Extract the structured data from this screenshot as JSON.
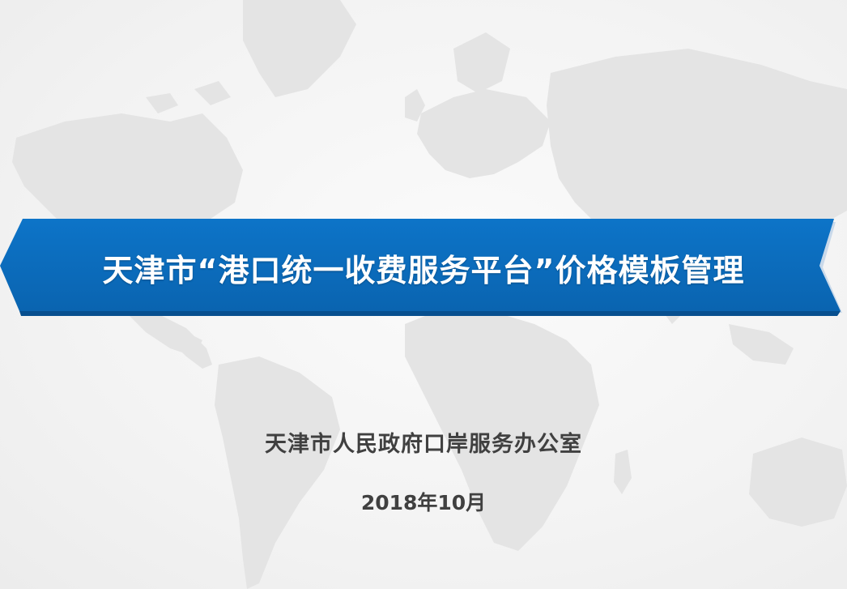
{
  "slide": {
    "title": "天津市“港口统一收费服务平台”价格模板管理",
    "organization": "天津市人民政府口岸服务办公室",
    "date": "2018年10月"
  },
  "colors": {
    "banner_main": "#0a6fc2",
    "banner_dark": "#074f8f",
    "banner_edge": "#c9d9ea",
    "text_dark": "#404040",
    "map_fill": "#e3e3e3",
    "background": "#f7f7f7"
  }
}
